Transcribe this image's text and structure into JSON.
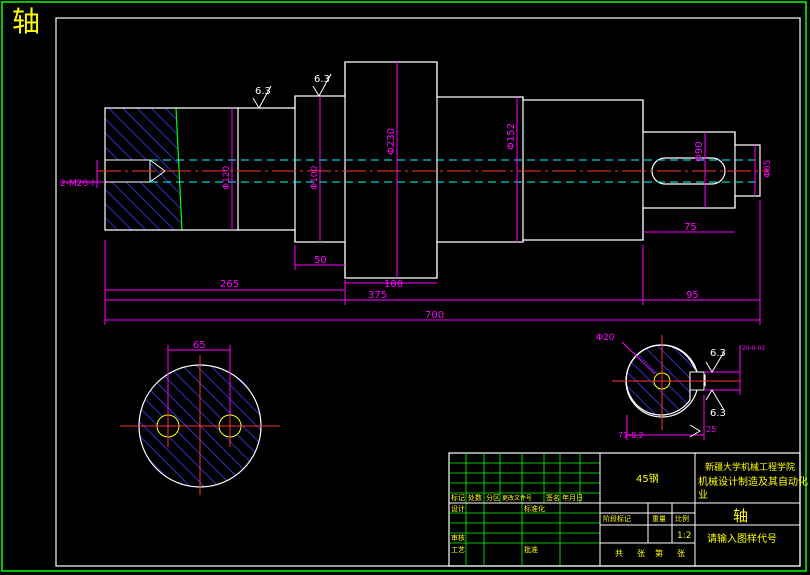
{
  "drawing": {
    "title": "轴",
    "dims": {
      "d_265": "265",
      "d_375": "375",
      "d_700": "700",
      "d_95": "95",
      "d_50": "50",
      "d_100": "100",
      "d_75": "75",
      "d_65": "65",
      "phi230": "Φ230",
      "phi152": "Φ152",
      "phi90": "Φ90",
      "phi65": "Φ65",
      "phi100": "Φ100",
      "phi120": "Φ120",
      "phi20": "Φ20",
      "tap": "2-M20-H",
      "key_width": "71-0.2",
      "key_tol": "20-0.02",
      "r25": "25"
    },
    "roughness": [
      "6.3",
      "6.3",
      "6.3",
      "6.3"
    ]
  },
  "title_block": {
    "material": "45钢",
    "school": "新疆大学机械工程学院",
    "major": "机械设计制造及其自动化",
    "major_cont": "业",
    "part_name": "轴",
    "drawing_no": "请输入图样代号",
    "scale": "1:2",
    "labels": {
      "mark": "标记",
      "count": "处数",
      "zone": "分区",
      "change_no": "更改文件号",
      "sign": "签名",
      "date": "年月日",
      "design": "设计",
      "standardize": "标准化",
      "stage_mark": "阶段标记",
      "weight": "重量",
      "ratio": "比例",
      "review": "审核",
      "process": "工艺",
      "approve": "批准",
      "total": "共",
      "sheet": "张",
      "page": "第",
      "sheet2": "张"
    }
  }
}
